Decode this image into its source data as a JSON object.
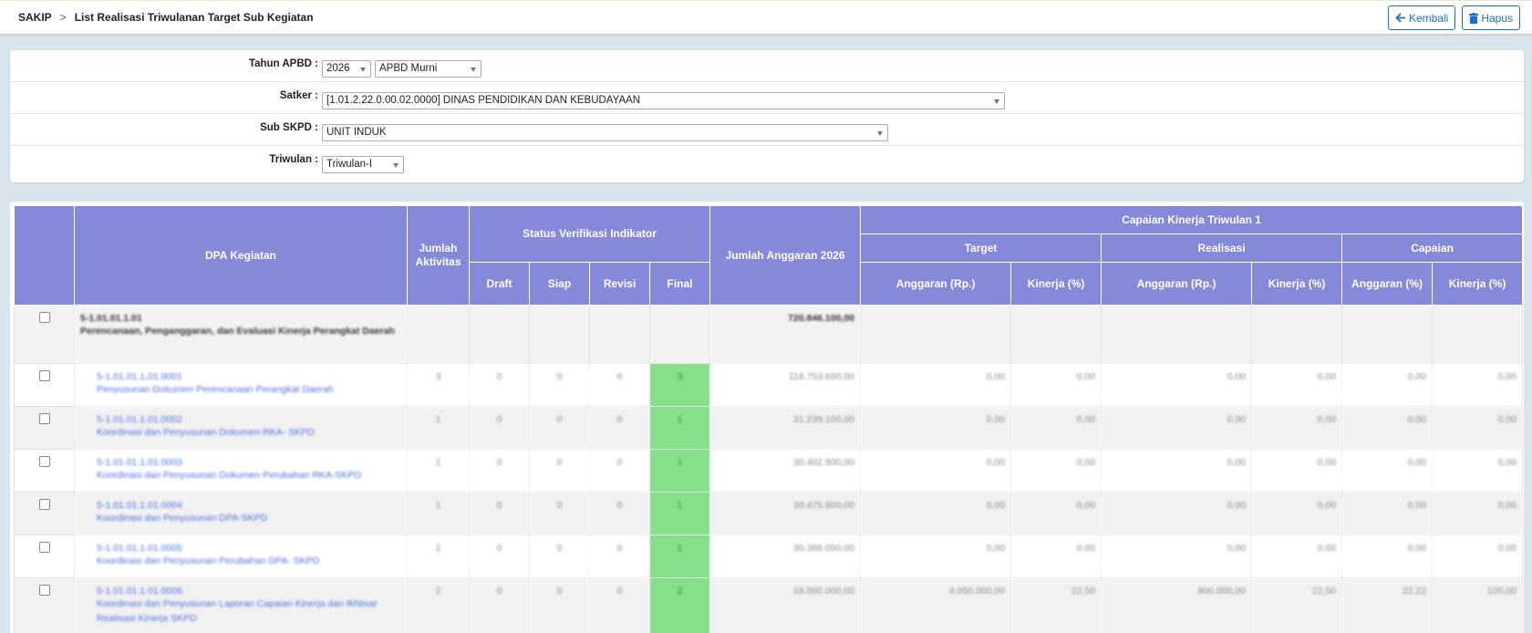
{
  "breadcrumb": {
    "root": "SAKIP",
    "separator": ">",
    "current": "List Realisasi Triwulanan Target Sub Kegiatan"
  },
  "actions": {
    "back_label": "Kembali",
    "delete_label": "Hapus"
  },
  "filters": {
    "tahun_label": "Tahun APBD :",
    "tahun_value": "2026",
    "apbd_value": "APBD Murni",
    "satker_label": "Satker :",
    "satker_value": "[1.01.2.22.0.00.02.0000] DINAS PENDIDIKAN DAN KEBUDAYAAN",
    "subskpd_label": "Sub SKPD :",
    "subskpd_value": "UNIT INDUK",
    "triwulan_label": "Triwulan :",
    "triwulan_value": "Triwulan-I"
  },
  "table": {
    "h_dpa": "DPA Kegiatan",
    "h_jumlah_aktivitas": "Jumlah Aktivitas",
    "h_status": "Status Verifikasi Indikator",
    "h_draft": "Draft",
    "h_siap": "Siap",
    "h_revisi": "Revisi",
    "h_final": "Final",
    "h_jumlah_anggaran": "Jumlah Anggaran 2026",
    "h_capaian_kinerja": "Capaian Kinerja Triwulan 1",
    "h_target": "Target",
    "h_realisasi": "Realisasi",
    "h_capaian": "Capaian",
    "h_anggaran_rp": "Anggaran (Rp.)",
    "h_kinerja_pct": "Kinerja (%)",
    "h_anggaran_pct": "Anggaran (%)",
    "parent": {
      "code": "5-1.01.01.1.01",
      "name": "Perencanaan, Penganggaran, dan Evaluasi Kinerja Perangkat Daerah",
      "anggaran": "720.846.100,00"
    },
    "rows": [
      {
        "code": "5-1.01.01.1.01.0001",
        "name": "Penyusunan Dokumen Perencanaan Perangkat Daerah",
        "aktivitas": "3",
        "draft": "0",
        "siap": "0",
        "revisi": "0",
        "final": "3",
        "anggaran": "118.753.650,00",
        "t_ang": "0,00",
        "t_kin": "0,00",
        "r_ang": "0,00",
        "r_kin": "0,00",
        "c_ang": "0,00",
        "c_kin": "0,00"
      },
      {
        "code": "5-1.01.01.1.01.0002",
        "name": "Koordinasi dan Penyusunan Dokumen RKA- SKPD",
        "aktivitas": "1",
        "draft": "0",
        "siap": "0",
        "revisi": "0",
        "final": "1",
        "anggaran": "31.239.100,00",
        "t_ang": "0,00",
        "t_kin": "0,00",
        "r_ang": "0,00",
        "r_kin": "0,00",
        "c_ang": "0,00",
        "c_kin": "0,00"
      },
      {
        "code": "5-1.01.01.1.01.0003",
        "name": "Koordinasi dan Penyusunan Dokumen Perubahan RKA-SKPD",
        "aktivitas": "1",
        "draft": "0",
        "siap": "0",
        "revisi": "0",
        "final": "1",
        "anggaran": "30.402.900,00",
        "t_ang": "0,00",
        "t_kin": "0,00",
        "r_ang": "0,00",
        "r_kin": "0,00",
        "c_ang": "0,00",
        "c_kin": "0,00"
      },
      {
        "code": "5-1.01.01.1.01.0004",
        "name": "Koordinasi dan Penyusunan DPA-SKPD",
        "aktivitas": "1",
        "draft": "0",
        "siap": "0",
        "revisi": "0",
        "final": "1",
        "anggaran": "30.475.800,00",
        "t_ang": "0,00",
        "t_kin": "0,00",
        "r_ang": "0,00",
        "r_kin": "0,00",
        "c_ang": "0,00",
        "c_kin": "0,00"
      },
      {
        "code": "5-1.01.01.1.01.0005",
        "name": "Koordinasi dan Penyusunan Perubahan DPA- SKPD",
        "aktivitas": "1",
        "draft": "0",
        "siap": "0",
        "revisi": "0",
        "final": "1",
        "anggaran": "30.388.050,00",
        "t_ang": "0,00",
        "t_kin": "0,00",
        "r_ang": "0,00",
        "r_kin": "0,00",
        "c_ang": "0,00",
        "c_kin": "0,00"
      },
      {
        "code": "5-1.01.01.1.01.0006",
        "name": "Koordinasi dan Penyusunan Laporan Capaian Kinerja dan Ikhtisar Realisasi Kinerja SKPD",
        "aktivitas": "2",
        "draft": "0",
        "siap": "0",
        "revisi": "0",
        "final": "2",
        "anggaran": "18.000.000,00",
        "t_ang": "4.050.000,00",
        "t_kin": "22,50",
        "r_ang": "900.000,00",
        "r_kin": "22,50",
        "c_ang": "22,22",
        "c_kin": "100,00"
      }
    ]
  },
  "colors": {
    "header_bg": "#8489d9",
    "final_bg": "#86e08a",
    "link": "#4b6fe0",
    "button": "#1a6fd1"
  }
}
